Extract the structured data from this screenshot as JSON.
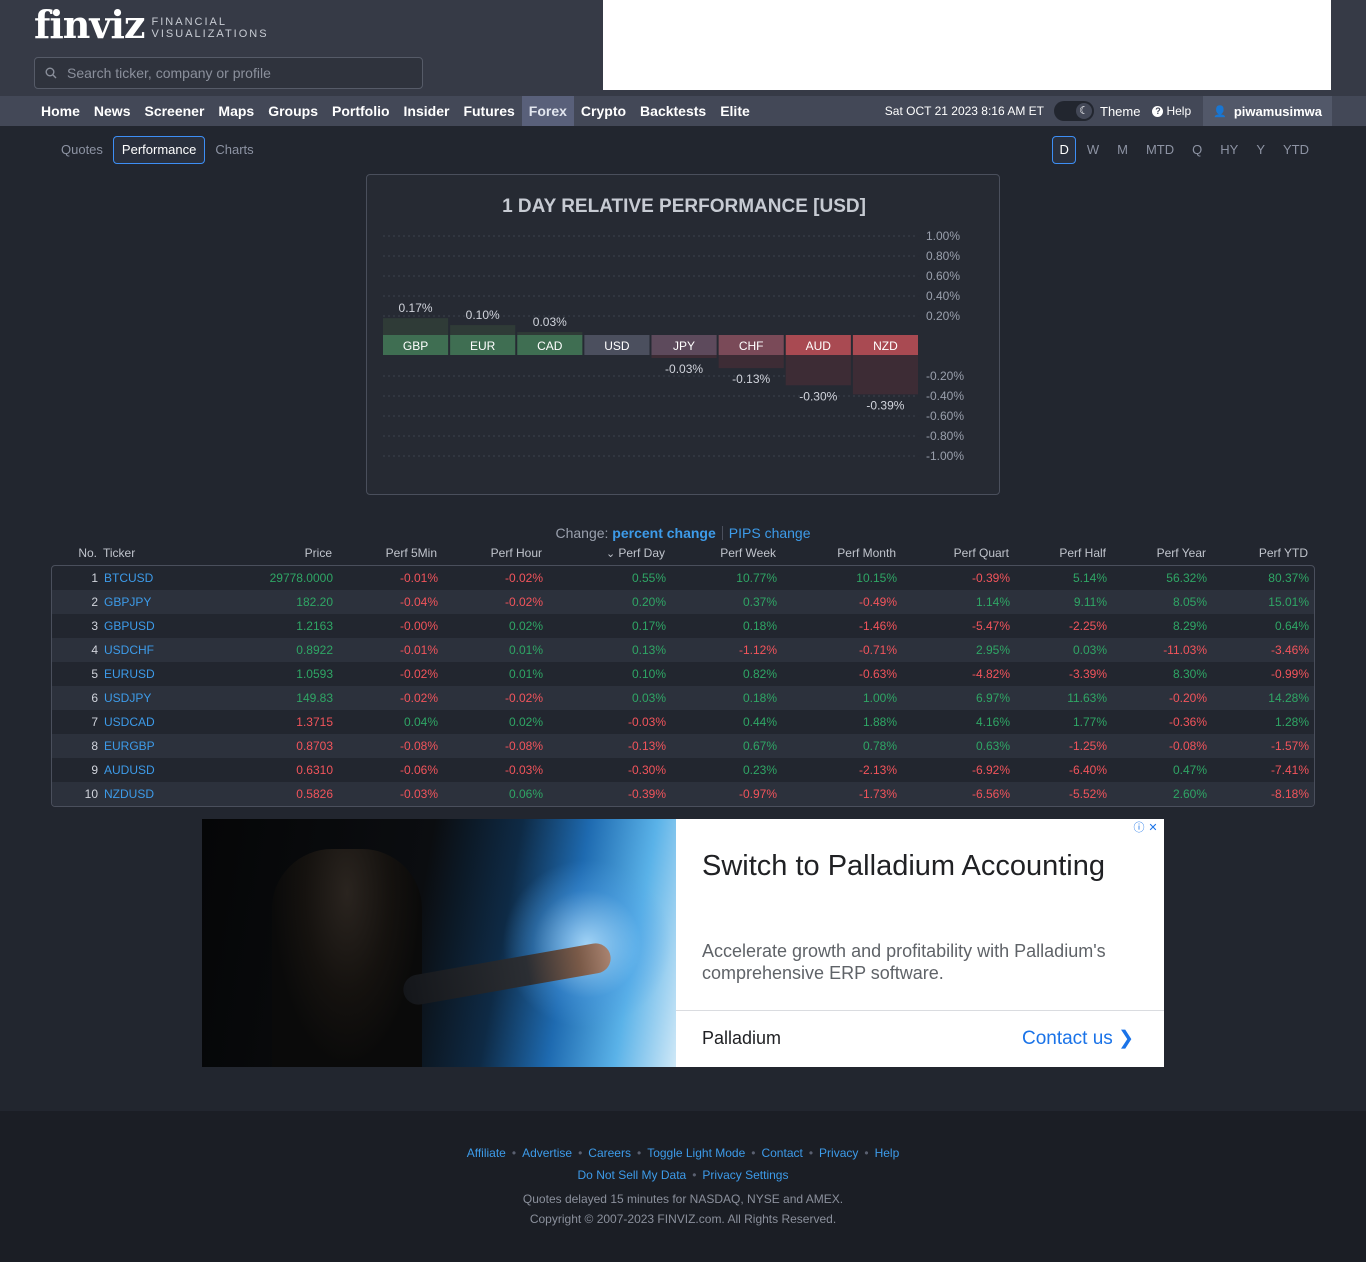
{
  "header": {
    "logo_main": "finviz",
    "logo_sub_line1": "FINANCIAL",
    "logo_sub_line2": "VISUALIZATIONS",
    "search_placeholder": "Search ticker, company or profile"
  },
  "nav": {
    "items": [
      "Home",
      "News",
      "Screener",
      "Maps",
      "Groups",
      "Portfolio",
      "Insider",
      "Futures",
      "Forex",
      "Crypto",
      "Backtests",
      "Elite"
    ],
    "active": "Forex",
    "date": "Sat OCT 21 2023 8:16 AM ET",
    "theme_label": "Theme",
    "help_label": "Help",
    "username": "piwamusimwa"
  },
  "subtabs": [
    "Quotes",
    "Performance",
    "Charts"
  ],
  "subtab_active": "Performance",
  "timeframes": [
    "D",
    "W",
    "M",
    "MTD",
    "Q",
    "HY",
    "Y",
    "YTD"
  ],
  "timeframe_active": "D",
  "colors": {
    "positive": "#2fa665",
    "negative": "#f2545b",
    "link": "#3d9be9",
    "accent_border": "#3d8ef5"
  },
  "chart_data": {
    "type": "bar",
    "title": "1 DAY RELATIVE PERFORMANCE  [USD]",
    "categories": [
      "GBP",
      "EUR",
      "CAD",
      "USD",
      "JPY",
      "CHF",
      "AUD",
      "NZD"
    ],
    "values": [
      0.17,
      0.1,
      0.03,
      0.0,
      -0.03,
      -0.13,
      -0.3,
      -0.39
    ],
    "value_labels": [
      "0.17%",
      "0.10%",
      "0.03%",
      "",
      "-0.03%",
      "-0.13%",
      "-0.30%",
      "-0.39%"
    ],
    "ylim": [
      -1.0,
      1.0
    ],
    "yticks_pos": [
      "1.00%",
      "0.80%",
      "0.60%",
      "0.40%",
      "0.20%"
    ],
    "yticks_neg": [
      "-0.20%",
      "-0.40%",
      "-0.60%",
      "-0.80%",
      "-1.00%"
    ],
    "grid": true
  },
  "table": {
    "change_label": "Change:",
    "change_pct": "percent change",
    "change_pips": "PIPS change",
    "columns": [
      "No.",
      "Ticker",
      "Price",
      "Perf 5Min",
      "Perf Hour",
      "Perf Day",
      "Perf Week",
      "Perf Month",
      "Perf Quart",
      "Perf Half",
      "Perf Year",
      "Perf YTD"
    ],
    "sort_icon": "chevron-down-icon",
    "rows": [
      [
        "1",
        "BTCUSD",
        "29778.0000",
        "-0.01%",
        "-0.02%",
        "0.55%",
        "10.77%",
        "10.15%",
        "-0.39%",
        "5.14%",
        "56.32%",
        "80.37%"
      ],
      [
        "2",
        "GBPJPY",
        "182.20",
        "-0.04%",
        "-0.02%",
        "0.20%",
        "0.37%",
        "-0.49%",
        "1.14%",
        "9.11%",
        "8.05%",
        "15.01%"
      ],
      [
        "3",
        "GBPUSD",
        "1.2163",
        "-0.00%",
        "0.02%",
        "0.17%",
        "0.18%",
        "-1.46%",
        "-5.47%",
        "-2.25%",
        "8.29%",
        "0.64%"
      ],
      [
        "4",
        "USDCHF",
        "0.8922",
        "-0.01%",
        "0.01%",
        "0.13%",
        "-1.12%",
        "-0.71%",
        "2.95%",
        "0.03%",
        "-11.03%",
        "-3.46%"
      ],
      [
        "5",
        "EURUSD",
        "1.0593",
        "-0.02%",
        "0.01%",
        "0.10%",
        "0.82%",
        "-0.63%",
        "-4.82%",
        "-3.39%",
        "8.30%",
        "-0.99%"
      ],
      [
        "6",
        "USDJPY",
        "149.83",
        "-0.02%",
        "-0.02%",
        "0.03%",
        "0.18%",
        "1.00%",
        "6.97%",
        "11.63%",
        "-0.20%",
        "14.28%"
      ],
      [
        "7",
        "USDCAD",
        "1.3715",
        "0.04%",
        "0.02%",
        "-0.03%",
        "0.44%",
        "1.88%",
        "4.16%",
        "1.77%",
        "-0.36%",
        "1.28%"
      ],
      [
        "8",
        "EURGBP",
        "0.8703",
        "-0.08%",
        "-0.08%",
        "-0.13%",
        "0.67%",
        "0.78%",
        "0.63%",
        "-1.25%",
        "-0.08%",
        "-1.57%"
      ],
      [
        "9",
        "AUDUSD",
        "0.6310",
        "-0.06%",
        "-0.03%",
        "-0.30%",
        "0.23%",
        "-2.13%",
        "-6.92%",
        "-6.40%",
        "0.47%",
        "-7.41%"
      ],
      [
        "10",
        "NZDUSD",
        "0.5826",
        "-0.03%",
        "0.06%",
        "-0.39%",
        "-0.97%",
        "-1.73%",
        "-6.56%",
        "-5.52%",
        "2.60%",
        "-8.18%"
      ]
    ],
    "price_sign": [
      "pos",
      "pos",
      "pos",
      "pos",
      "pos",
      "pos",
      "neg",
      "neg",
      "neg",
      "neg"
    ]
  },
  "ad": {
    "title": "Switch to Palladium Accounting",
    "description": "Accelerate growth and profitability with Palladium's comprehensive ERP software.",
    "brand": "Palladium",
    "cta": "Contact us",
    "info_icon": "info-icon",
    "close_icon": "close-icon"
  },
  "footer": {
    "links1": [
      "Affiliate",
      "Advertise",
      "Careers",
      "Toggle Light Mode",
      "Contact",
      "Privacy",
      "Help"
    ],
    "links2": [
      "Do Not Sell My Data",
      "Privacy Settings"
    ],
    "note1": "Quotes delayed 15 minutes for NASDAQ, NYSE and AMEX.",
    "note2": "Copyright © 2007-2023 FINVIZ.com. All Rights Reserved."
  }
}
